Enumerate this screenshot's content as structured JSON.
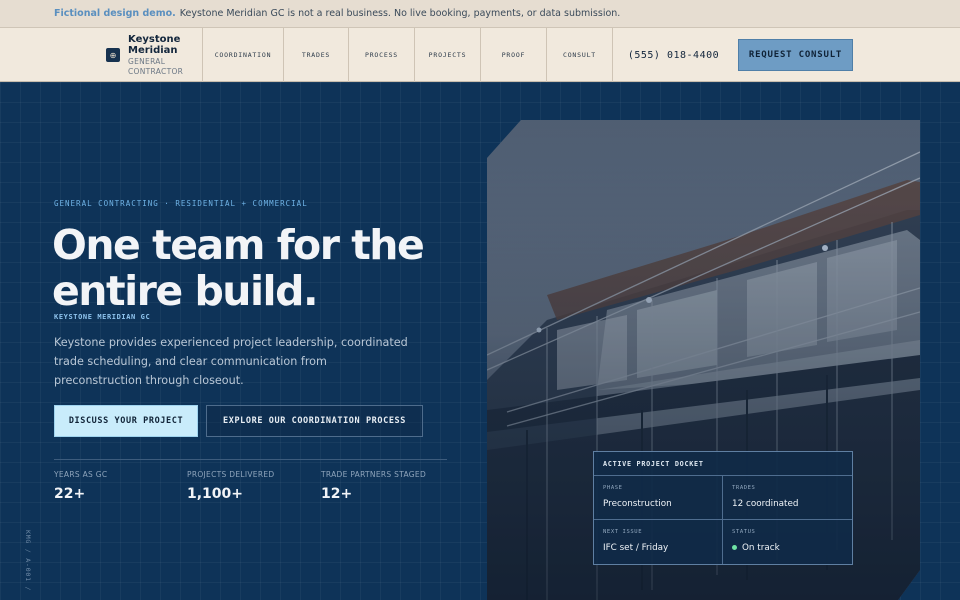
{
  "notice": {
    "lead": "Fictional design demo.",
    "text": "Keystone Meridian GC is not a real business. No live booking, payments, or data submission."
  },
  "brand": {
    "name_line1": "Keystone",
    "name_line2": "Meridian",
    "sub_line1": "General",
    "sub_line2": "Contractor",
    "icon": "plus-circle-icon"
  },
  "nav": {
    "items": [
      "COORDINATION",
      "TRADES",
      "PROCESS",
      "PROJECTS",
      "PROOF",
      "CONSULT"
    ],
    "phone": "(555) 018-4400",
    "cta": "REQUEST CONSULT"
  },
  "hero": {
    "eyebrow": "GENERAL CONTRACTING · RESIDENTIAL + COMMERCIAL",
    "headline_line1": "One team for the",
    "headline_line2": "entire build.",
    "kicker": "KEYSTONE MERIDIAN GC",
    "lede": "Keystone provides experienced project leadership, coordinated trade scheduling, and clear communication from preconstruction through closeout.",
    "primary_cta": "DISCUSS YOUR PROJECT",
    "secondary_cta": "EXPLORE OUR COORDINATION PROCESS",
    "side_mark": "KMG / A-001 /"
  },
  "stats": [
    {
      "label": "Years as GC",
      "value": "22+"
    },
    {
      "label": "Projects delivered",
      "value": "1,100+"
    },
    {
      "label": "Trade partners staged",
      "value": "12+"
    }
  ],
  "docket": {
    "title": "ACTIVE PROJECT DOCKET",
    "cells": [
      {
        "label": "Phase",
        "value": "Preconstruction"
      },
      {
        "label": "Trades",
        "value": "12 coordinated"
      },
      {
        "label": "Next issue",
        "value": "IFC set / Friday"
      },
      {
        "label": "Status",
        "value": "On track"
      }
    ],
    "status_color": "#6fe3a5"
  },
  "colors": {
    "hero_bg": "#0e3358",
    "header_bg": "#f1e9dd",
    "accent": "#6e9cc4",
    "primary_btn": "#c9ecfb"
  }
}
